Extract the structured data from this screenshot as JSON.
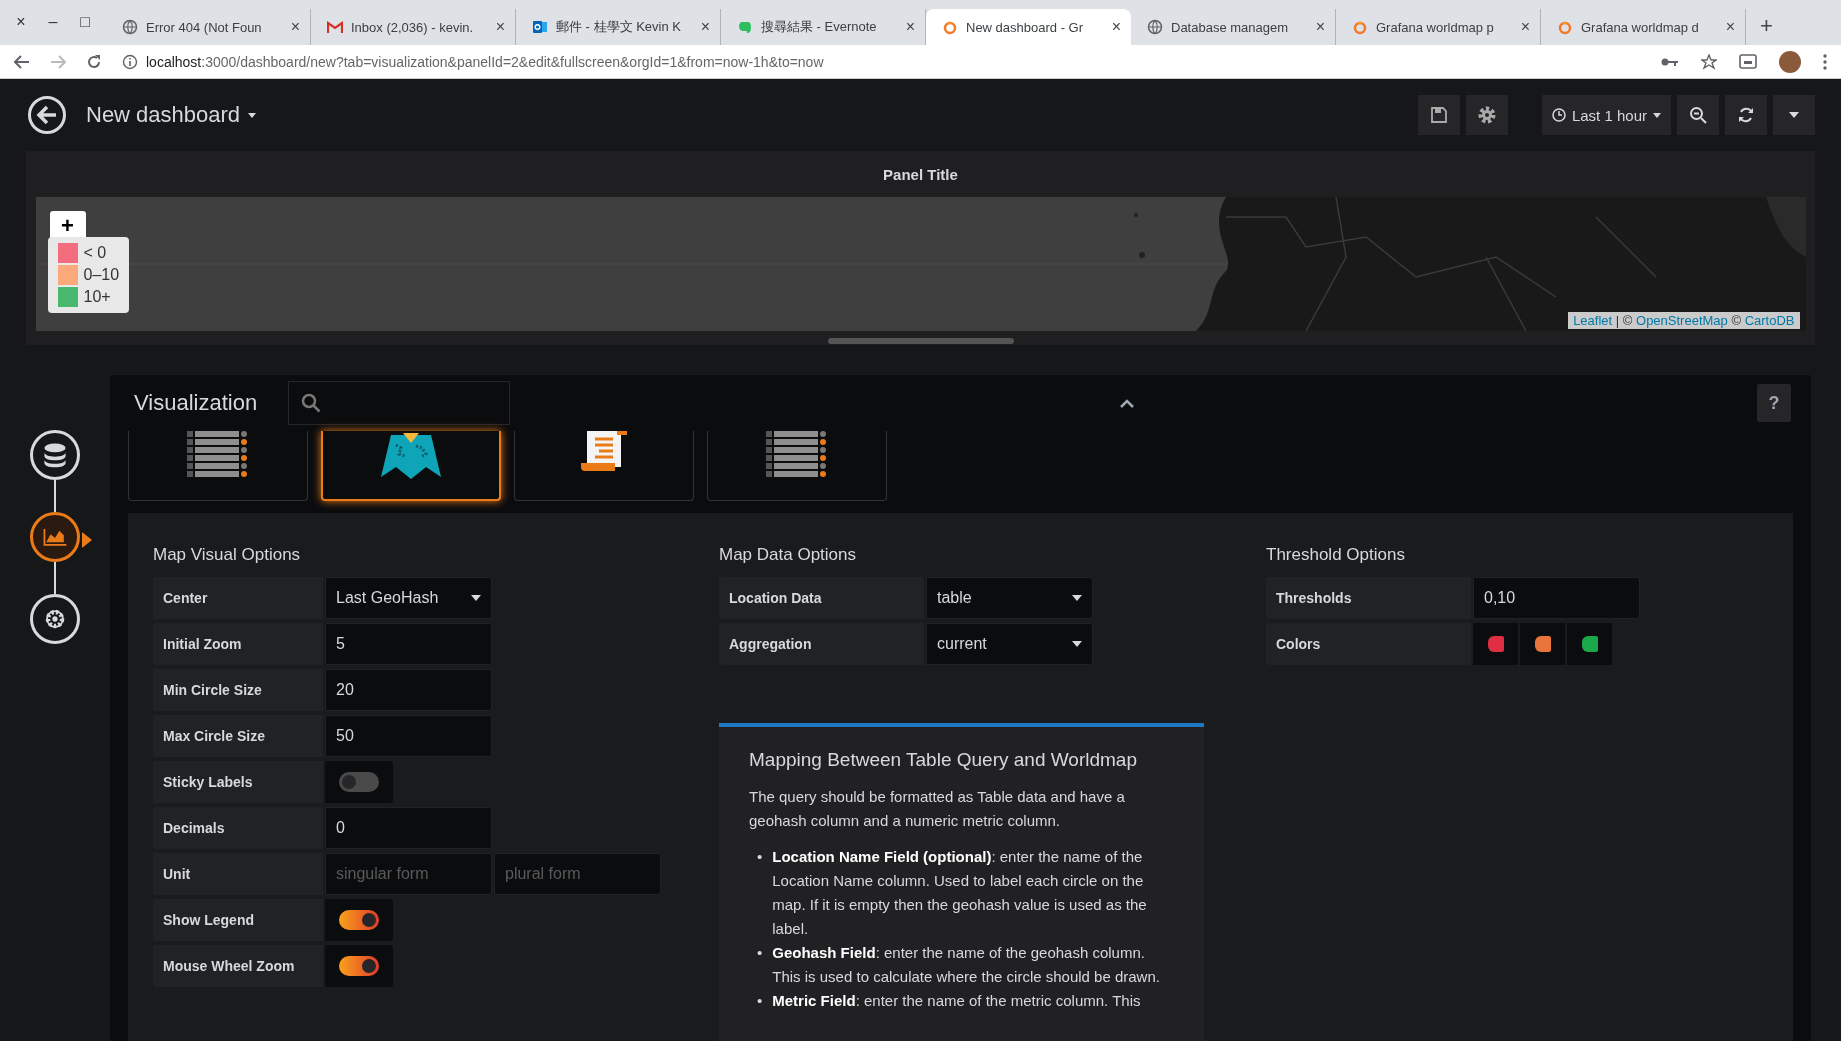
{
  "browser": {
    "window_controls": [
      "×",
      "–",
      "□"
    ],
    "tabs": [
      {
        "title": "Error 404 (Not Foun",
        "kind": "globe",
        "selected": false,
        "close": "×"
      },
      {
        "title": "Inbox (2,036) - kevin.",
        "kind": "mail",
        "selected": false,
        "close": "×"
      },
      {
        "title": "郵件 - 桂學文 Kevin K",
        "kind": "outlook",
        "selected": false,
        "close": "×"
      },
      {
        "title": "搜尋結果 - Evernote",
        "kind": "evernote",
        "selected": false,
        "close": "×"
      },
      {
        "title": "New dashboard - Gr",
        "kind": "grafana",
        "selected": true,
        "close": "×"
      },
      {
        "title": "Database managem",
        "kind": "globe",
        "selected": false,
        "close": "×"
      },
      {
        "title": "Grafana worldmap p",
        "kind": "grafana",
        "selected": false,
        "close": "×"
      },
      {
        "title": "Grafana worldmap d",
        "kind": "grafana",
        "selected": false,
        "close": "×"
      }
    ],
    "new_tab": "+",
    "url_host": "localhost",
    "url_rest": ":3000/dashboard/new?tab=visualization&panelId=2&edit&fullscreen&orgId=1&from=now-1h&to=now"
  },
  "header": {
    "title": "New dashboard",
    "time_range": "Last 1 hour"
  },
  "panel": {
    "title": "Panel Title",
    "zoom_in": "+",
    "legend": [
      {
        "label": "< 0",
        "color": "#f46d7e"
      },
      {
        "label": "0–10",
        "color": "#fba97a"
      },
      {
        "label": "10+",
        "color": "#4bb86f"
      }
    ],
    "attribution": {
      "links": [
        "Leaflet",
        "OpenStreetMap",
        "CartoDB"
      ],
      "separators": [
        "| ©",
        "©"
      ]
    }
  },
  "nav": [
    {
      "kind": "queries",
      "selected": false
    },
    {
      "kind": "visualization",
      "selected": true
    },
    {
      "kind": "general",
      "selected": false
    }
  ],
  "visualization": {
    "title": "Visualization",
    "help": "?",
    "plugins": [
      {
        "kind": "list",
        "selected": false
      },
      {
        "kind": "worldmap",
        "selected": true
      },
      {
        "kind": "text",
        "selected": false
      },
      {
        "kind": "list",
        "selected": false
      }
    ]
  },
  "visual_options": {
    "title": "Map Visual Options",
    "rows": [
      {
        "kind": "select",
        "label": "Center",
        "value": "Last GeoHash"
      },
      {
        "kind": "input",
        "label": "Initial Zoom",
        "value": "5"
      },
      {
        "kind": "input",
        "label": "Min Circle Size",
        "value": "20"
      },
      {
        "kind": "input",
        "label": "Max Circle Size",
        "value": "50"
      },
      {
        "kind": "switch",
        "label": "Sticky Labels",
        "on": false
      },
      {
        "kind": "input",
        "label": "Decimals",
        "value": "0"
      },
      {
        "kind": "pair",
        "label": "Unit",
        "placeholders": [
          "singular form",
          "plural form"
        ]
      },
      {
        "kind": "switch",
        "label": "Show Legend",
        "on": true
      },
      {
        "kind": "switch",
        "label": "Mouse Wheel Zoom",
        "on": true
      }
    ]
  },
  "data_options": {
    "title": "Map Data Options",
    "rows": [
      {
        "kind": "select",
        "label": "Location Data",
        "value": "table"
      },
      {
        "kind": "select",
        "label": "Aggregation",
        "value": "current"
      }
    ]
  },
  "threshold_options": {
    "title": "Threshold Options",
    "rows": [
      {
        "kind": "input",
        "label": "Thresholds",
        "value": "0,10"
      },
      {
        "kind": "colors",
        "label": "Colors",
        "colors": [
          {
            "color": "#e02f44"
          },
          {
            "color": "#e8743b"
          },
          {
            "color": "#1aa84a"
          }
        ]
      }
    ]
  },
  "help": {
    "title": "Mapping Between Table Query and Worldmap",
    "intro": "The query should be formatted as Table data and have a geohash column and a numeric metric column.",
    "bullets": [
      {
        "marker": "•",
        "text": "**Location Name Field (optional)**: enter the name of the Location Name column. Used to label each circle on the map. If it is empty then the geohash value is used as the label."
      },
      {
        "marker": "•",
        "text": "**Geohash Field**: enter the name of the geohash column. This is used to calculate where the circle should be drawn."
      },
      {
        "marker": "•",
        "text": "**Metric Field**: enter the name of the metric column. This"
      }
    ]
  }
}
